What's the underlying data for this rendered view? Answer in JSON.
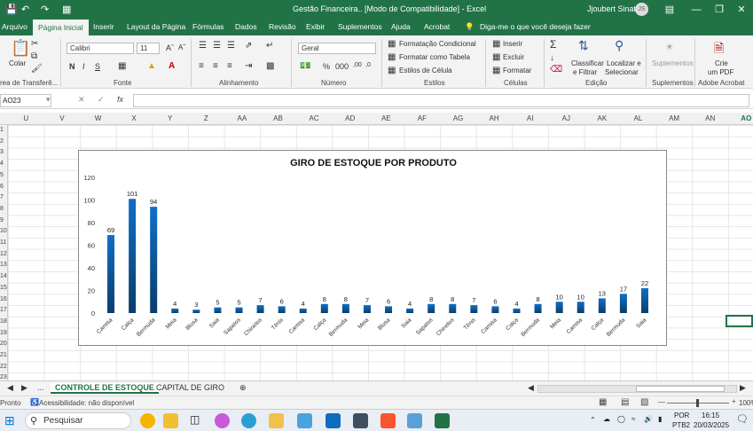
{
  "window": {
    "title": "Gestão Financeira..  [Modo de Compatibilidade]  -  Excel",
    "user": "Jjoubert Sinata",
    "avatar": "JS",
    "search_ribbon": "Diga-me o que você deseja fazer"
  },
  "menu": {
    "tabs": [
      "Arquivo",
      "Página Inicial",
      "Inserir",
      "Layout da Página",
      "Fórmulas",
      "Dados",
      "Revisão",
      "Exibir",
      "Suplementos",
      "Ajuda",
      "Acrobat"
    ]
  },
  "ribbon": {
    "paste": "Colar",
    "clipboard": "rea de Transferê...",
    "font_name": "Calibri",
    "font_size": "11",
    "font_group": "Fonte",
    "align_group": "Alinhamento",
    "number_format": "Geral",
    "number_group": "Número",
    "cond_format": "Formatação Condicional",
    "format_table": "Formatar como Tabela",
    "cell_styles": "Estilos de Célula",
    "styles_group": "Estilos",
    "insert": "Inserir",
    "delete": "Excluir",
    "format": "Formatar",
    "cells_group": "Células",
    "sort_filter_1": "Classificar",
    "sort_filter_2": "e Filtrar",
    "find_1": "Localizar e",
    "find_2": "Selecionar",
    "editing_group": "Edição",
    "addins": "Suplementos",
    "addins_group": "Suplementos",
    "pdf_1": "Crie",
    "pdf_2": "um PDF",
    "acrobat_group": "Adobe Acrobat"
  },
  "formula_bar": {
    "name_box": "AO23",
    "fx": "fx",
    "value": ""
  },
  "columns": [
    "U",
    "V",
    "W",
    "X",
    "Y",
    "Z",
    "AA",
    "AB",
    "AC",
    "AD",
    "AE",
    "AF",
    "AG",
    "AH",
    "AI",
    "AJ",
    "AK",
    "AL",
    "AM",
    "AN",
    "AO"
  ],
  "rows": [
    "1",
    "2",
    "3",
    "4",
    "5",
    "6",
    "7",
    "8",
    "9",
    "10",
    "11",
    "12",
    "13",
    "14",
    "15",
    "16",
    "17",
    "18",
    "19",
    "20",
    "21",
    "22",
    "23"
  ],
  "sheets": {
    "ellipsis": "...",
    "active": "CONTROLE DE ESTOQUE",
    "other": "CAPITAL DE GIRO"
  },
  "status": {
    "ready": "Pronto",
    "accessibility": "Acessibilidade: não disponível",
    "zoom": "100%"
  },
  "taskbar": {
    "search": "Pesquisar",
    "lang_1": "POR",
    "lang_2": "PTB2",
    "time": "16:15",
    "date": "20/03/2025"
  },
  "colors": {
    "excel_green": "#217346",
    "bar_top": "#0f6fc6",
    "bar_bottom": "#0a3d6b"
  },
  "chart_data": {
    "type": "bar",
    "title": "GIRO DE ESTOQUE POR PRODUTO",
    "categories": [
      "Camisa",
      "Calça",
      "Bermuda",
      "Meia",
      "Blusa",
      "Saia",
      "Sapatos",
      "Chinelos",
      "Tênis",
      "Camisa",
      "Calça",
      "Bermuda",
      "Meia",
      "Blusa",
      "Saia",
      "Sapatos",
      "Chinelos",
      "Tênis",
      "Camisa",
      "Calça",
      "Bermuda",
      "Meia",
      "Camisa",
      "Calça",
      "Bermuda",
      "Saia"
    ],
    "values": [
      69,
      101,
      94,
      4,
      3,
      5,
      5,
      7,
      6,
      4,
      8,
      8,
      7,
      6,
      4,
      8,
      8,
      7,
      6,
      4,
      8,
      10,
      10,
      13,
      17,
      22
    ],
    "yticks": [
      0,
      20,
      40,
      60,
      80,
      100,
      120
    ],
    "ylim": [
      0,
      120
    ],
    "data_labels": true,
    "grid": false,
    "legend": "none"
  }
}
